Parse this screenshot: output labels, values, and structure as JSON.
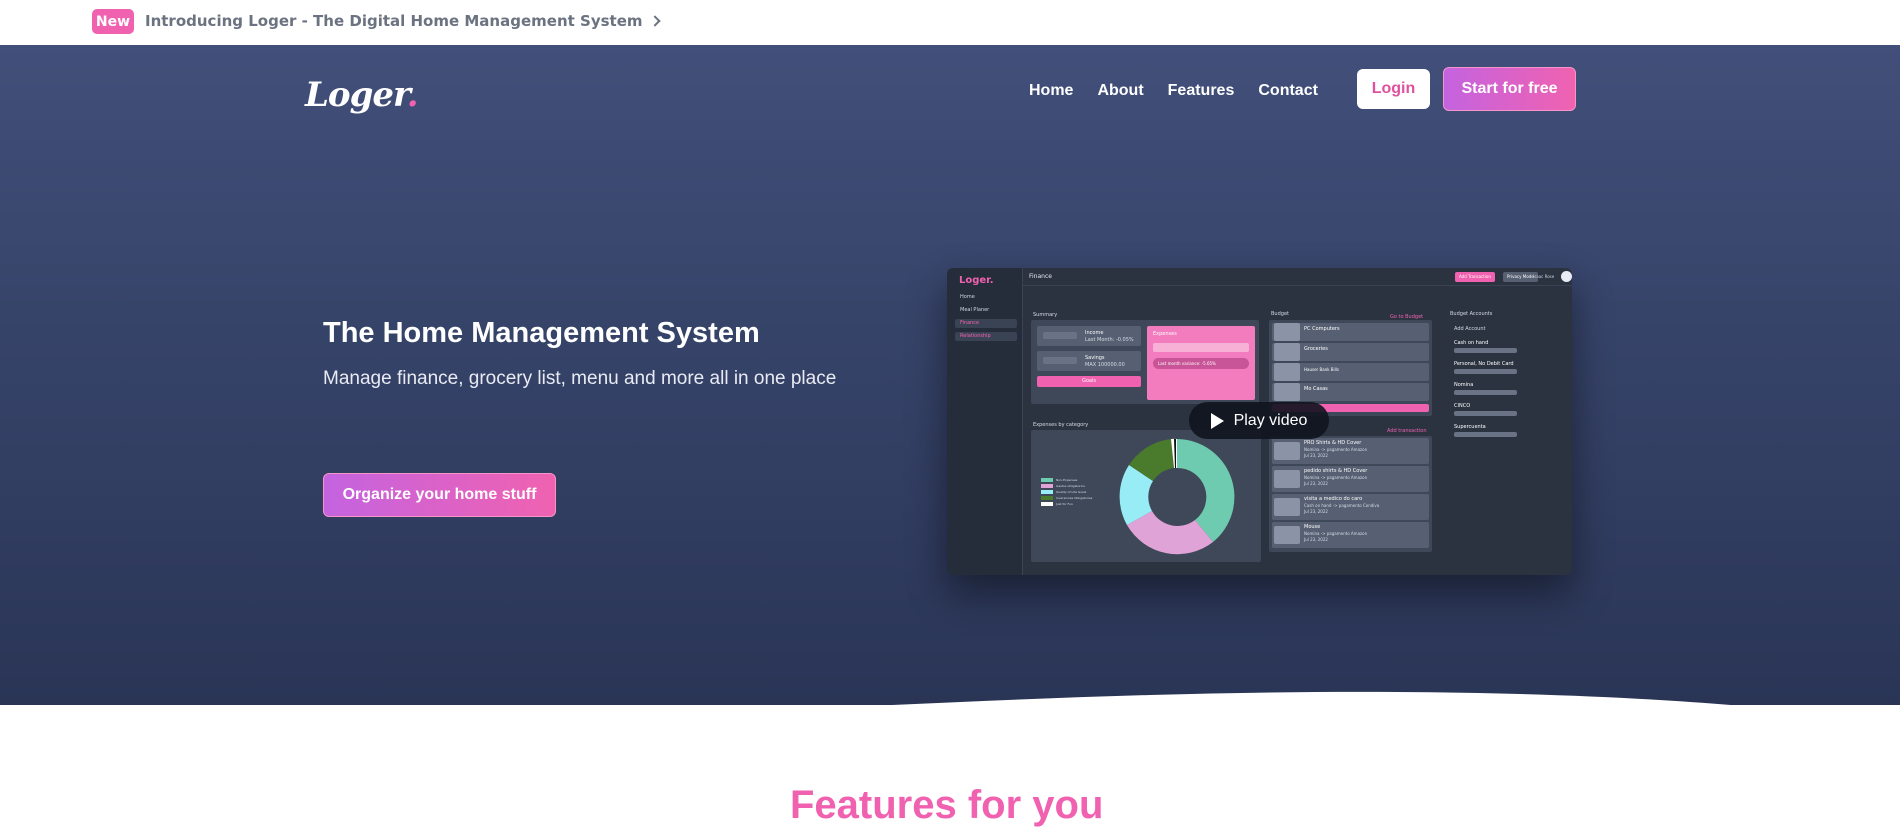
{
  "announcement": {
    "badge": "New",
    "text": "Introducing Loger - The Digital Home Management System"
  },
  "brand": {
    "name": "Loger",
    "dot": ".",
    "accent": "#f062b0"
  },
  "nav": {
    "items": [
      "Home",
      "About",
      "Features",
      "Contact"
    ],
    "login": "Login",
    "start": "Start for free"
  },
  "hero": {
    "title": "The Home Management System",
    "subtitle": "Manage finance, grocery list, menu and more all in one place",
    "cta": "Organize your home stuff"
  },
  "preview": {
    "logo": "Loger.",
    "sidebar": [
      "Home",
      "Meal Planer",
      "Finance",
      "Relationship"
    ],
    "header_title": "Finance",
    "header_buttons": [
      "Add Transaction",
      "Privacy Mode"
    ],
    "header_user": "Isaac Rose",
    "summary_title": "Summary",
    "summary_income_label": "Income",
    "summary_income_sub": "Last Month: -0.05%",
    "summary_savings_label": "Savings",
    "summary_savings_sub": "MAX 100000.00",
    "summary_expenses_label": "Expenses",
    "summary_expenses_sub": "Last month variance: -5.65%",
    "summary_button": "Goals",
    "budget_title": "Budget",
    "budget_link": "Go to Budget",
    "budget_items": [
      "PC Computers",
      "Groceries",
      "Hauser Bank Bills",
      "Mo Casas"
    ],
    "accounts_title": "Budget Accounts",
    "add_account": "Add Account",
    "accounts": [
      "Cash on hand",
      "Personal, No Debit Card",
      "Nomina",
      "CINCO",
      "Supercuenta"
    ],
    "expenses_cat_title": "Expenses by category",
    "add_transaction": "Add transaction",
    "legend": [
      "Non-Expenses",
      "Gastos obligatorios",
      "Quality of Life Goals",
      "Inversiones Obligatorias",
      "Just for Fun"
    ],
    "transactions": [
      {
        "title": "PRO Shirts & HD Cover",
        "sub": "Nomina -> pagamento Amazon",
        "date": "Jul 23, 2022"
      },
      {
        "title": "pedido shirts & HD Cover",
        "sub": "Nomina -> pagamento Amazon",
        "date": "Jul 23, 2022"
      },
      {
        "title": "visita a medico do caro",
        "sub": "Cash on hand -> pagamento Condiva",
        "date": "Jul 23, 2022"
      },
      {
        "title": "Mouse",
        "sub": "Nomina -> pagamento Amazon",
        "date": "Jul 23, 2022"
      }
    ],
    "play_label": "Play video"
  },
  "next_section": {
    "title_peek": "Features for you"
  }
}
